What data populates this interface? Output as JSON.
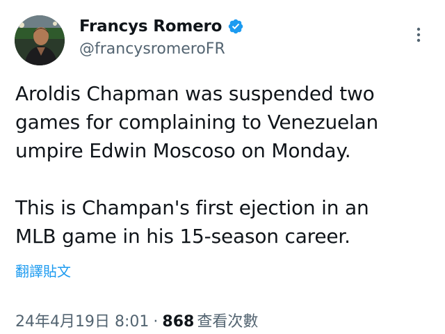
{
  "author": {
    "display_name": "Francys Romero",
    "handle": "@francysromeroFR",
    "verified": true
  },
  "tweet": {
    "paragraphs": [
      "Aroldis Chapman was suspended two\ngames for complaining to Venezuelan\numpire Edwin Moscoso on Monday.",
      "This is Champan's first ejection in an\nMLB game in his 15-season career."
    ],
    "translate_label": "翻譯貼文"
  },
  "meta": {
    "timestamp": "24年4月19日 8:01",
    "separator": "·",
    "views_count": "868",
    "views_label": "查看次數"
  },
  "icons": {
    "verified": "verified-badge-icon",
    "more": "more-vertical-icon"
  },
  "colors": {
    "accent": "#1d9bf0",
    "text_primary": "#0f1419",
    "text_secondary": "#536471"
  }
}
